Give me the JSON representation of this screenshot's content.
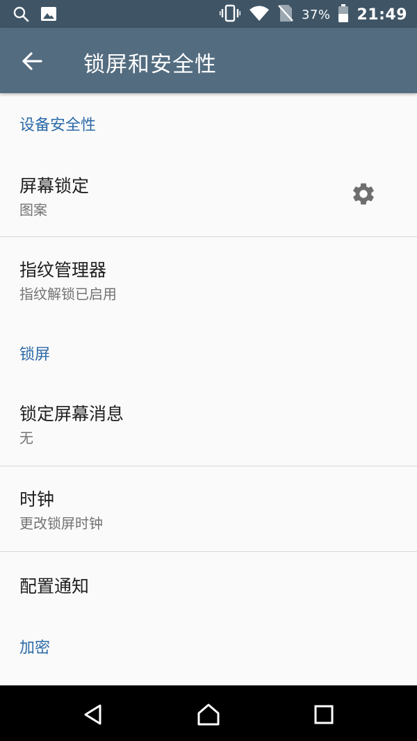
{
  "status_bar": {
    "battery_percent": "37%",
    "time": "21:49"
  },
  "app_bar": {
    "title": "锁屏和安全性"
  },
  "sections": {
    "device_security": "设备安全性",
    "lock_screen": "锁屏",
    "encryption": "加密"
  },
  "items": {
    "screen_lock": {
      "title": "屏幕锁定",
      "subtitle": "图案"
    },
    "fingerprint": {
      "title": "指纹管理器",
      "subtitle": "指纹解锁已启用"
    },
    "lock_message": {
      "title": "锁定屏幕消息",
      "subtitle": "无"
    },
    "clock": {
      "title": "时钟",
      "subtitle": "更改锁屏时钟"
    },
    "notifications": {
      "title": "配置通知"
    }
  },
  "colors": {
    "status_bar": "#3f5566",
    "app_bar": "#536c80",
    "accent": "#2b6aa8",
    "background": "#fafafa"
  },
  "icons": {
    "status_left": [
      "search-icon",
      "image-icon"
    ],
    "status_right": [
      "vibrate-icon",
      "wifi-icon",
      "no-sim-icon",
      "battery-icon"
    ],
    "settings": "gear-icon",
    "nav": [
      "back-triangle-icon",
      "home-icon",
      "recents-icon"
    ]
  }
}
